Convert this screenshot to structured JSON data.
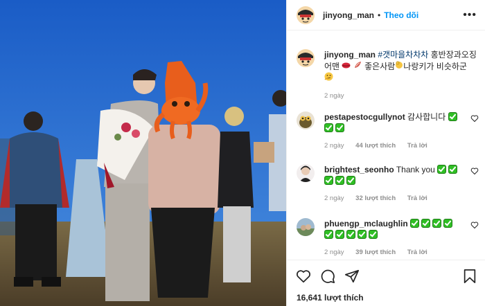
{
  "header": {
    "username": "jinyong_man",
    "separator": "•",
    "follow_label": "Theo dõi",
    "more_label": "•••"
  },
  "caption": {
    "username": "jinyong_man",
    "hashtag": "#갯마을차차차",
    "text_part1": " 홍반장과오징어맨",
    "text_part2": " 좋은사람",
    "text_part3": "나랑키가 비슷하군",
    "emoji_names": [
      "lips-icon",
      "bacon-icon",
      "ok-hand-icon",
      "thinking-face-icon"
    ],
    "time": "2 ngày"
  },
  "comments": [
    {
      "username": "pestapestocgullynot",
      "text": "감사합니다",
      "green_checks": 3,
      "time": "2 ngày",
      "likes": "44 lượt thích",
      "reply": "Trả lời"
    },
    {
      "username": "brightest_seonho",
      "text": "Thank you",
      "green_checks": 5,
      "time": "2 ngày",
      "likes": "32 lượt thích",
      "reply": "Trả lời"
    },
    {
      "username": "phuengp_mclaughlin",
      "text": "",
      "green_checks": 9,
      "time": "2 ngày",
      "likes": "39 lượt thích",
      "reply": "Trả lời"
    }
  ],
  "actions": {
    "icons": [
      "heart-icon",
      "comment-icon",
      "share-icon",
      "bookmark-icon"
    ],
    "likes_count": "16,641 lượt thích"
  },
  "colors": {
    "follow_blue": "#0095f6",
    "hashtag_blue": "#00376b",
    "secondary_text": "#8e8e8e",
    "green_check": "#2fbf24"
  }
}
